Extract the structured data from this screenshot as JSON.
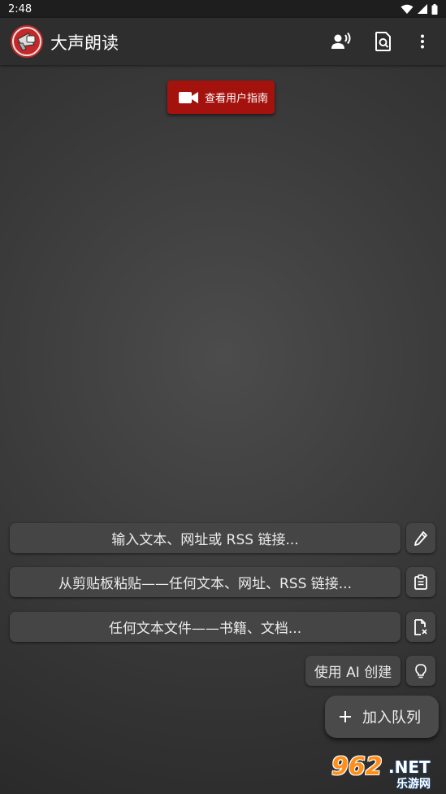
{
  "status_bar": {
    "time": "2:48"
  },
  "app_bar": {
    "title": "大声朗读"
  },
  "guide_button": {
    "label": "查看用户指南"
  },
  "actions": [
    {
      "label": "输入文本、网址或 RSS 链接...",
      "icon": "pencil-icon"
    },
    {
      "label": "从剪贴板粘贴——任何文本、网址、RSS 链接...",
      "icon": "clipboard-icon"
    },
    {
      "label": "任何文本文件——书籍、文档...",
      "icon": "file-icon"
    },
    {
      "label": "使用 AI 创建",
      "icon": "lightbulb-icon"
    }
  ],
  "fab": {
    "label": "加入队列"
  },
  "watermark": {
    "number": "962",
    "suffix": ".NET",
    "site": "乐游网"
  },
  "colors": {
    "accent_red": "#a3120d",
    "appbar": "#2e2e2e",
    "pill": "#454545"
  }
}
